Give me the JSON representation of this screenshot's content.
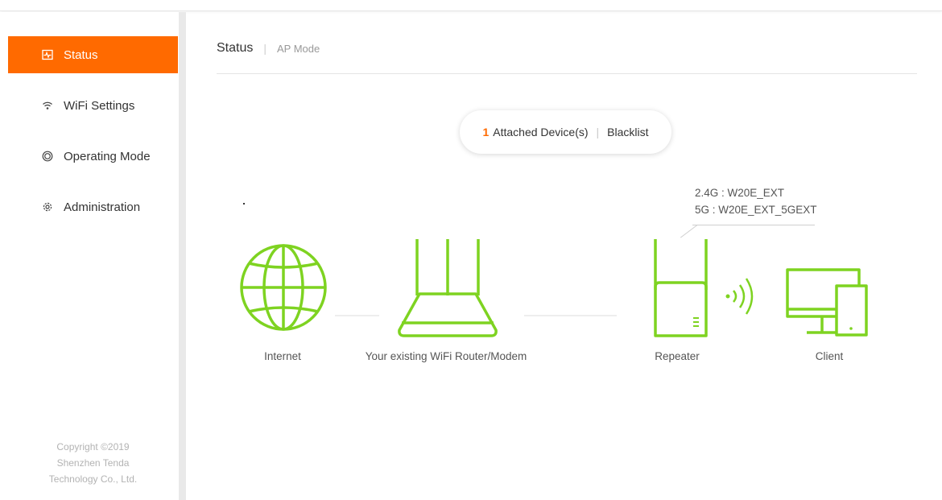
{
  "sidebar": {
    "items": [
      {
        "label": "Status",
        "icon": "pulse-icon",
        "active": true
      },
      {
        "label": "WiFi Settings",
        "icon": "wifi-icon",
        "active": false
      },
      {
        "label": "Operating Mode",
        "icon": "mode-icon",
        "active": false
      },
      {
        "label": "Administration",
        "icon": "gear-icon",
        "active": false
      }
    ],
    "copyright": [
      "Copyright ©2019",
      "Shenzhen Tenda",
      "Technology Co., Ltd."
    ]
  },
  "header": {
    "title": "Status",
    "mode": "AP Mode"
  },
  "devices": {
    "count": "1",
    "attached_label": "Attached Device(s)",
    "separator": "|",
    "blacklist_label": "Blacklist"
  },
  "ssids": {
    "band_24": "2.4G :  W20E_EXT",
    "band_5": "5G :  W20E_EXT_5GEXT"
  },
  "topology": {
    "internet": "Internet",
    "router": "Your existing WiFi Router/Modem",
    "repeater": "Repeater",
    "client": "Client"
  },
  "colors": {
    "accent": "#ff6a00",
    "diagram_green": "#7ed321"
  }
}
